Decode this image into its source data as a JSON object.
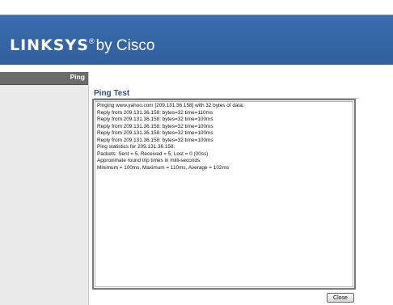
{
  "brand": {
    "name": "LINKSYS",
    "registered": "®",
    "by": "by Cisco"
  },
  "sidebar": {
    "items": [
      {
        "label": "Ping"
      }
    ]
  },
  "main": {
    "title": "Ping Test",
    "output_lines": [
      "Pinging www.yahoo.com [209.131.36.158] with 32 bytes of data:",
      "Reply from 209.131.36.158: bytes=32 time=110ms",
      "Reply from 209.131.36.158: bytes=32 time=100ms",
      "Reply from 209.131.36.158: bytes=32 time=100ms",
      "Reply from 209.131.36.158: bytes=32 time=100ms",
      "Reply from 209.131.36.158: bytes=32 time=100ms",
      "Ping statistics for 209.131.36.158:",
      "Packets: Sent = 5, Received = 5, Lost = 0 (00ss)",
      "Approximate round trip times in milli-seconds:",
      "Minimum = 100ms, Maximum = 110ms, Average = 102ms"
    ],
    "close_label": "Close"
  },
  "colors": {
    "brand_band": "#2f5f9f",
    "title": "#2f4f87",
    "sidebar_item": "#6b6b6b"
  }
}
